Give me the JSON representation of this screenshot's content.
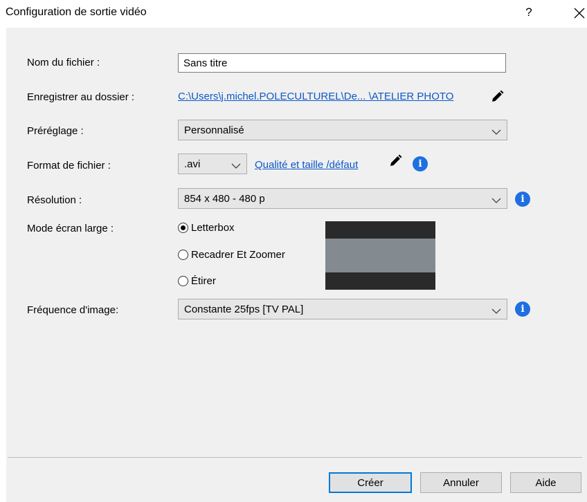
{
  "window": {
    "title": "Configuration de sortie vidéo",
    "help_label": "?"
  },
  "form": {
    "filename": {
      "label": "Nom du fichier :",
      "value": "Sans titre"
    },
    "folder": {
      "label": "Enregistrer au dossier :",
      "path": "C:\\Users\\j.michel.POLECULTUREL\\De... \\ATELIER PHOTO"
    },
    "preset": {
      "label": "Préréglage :",
      "value": "Personnalisé"
    },
    "format": {
      "label": "Format de fichier :",
      "value": ".avi",
      "quality_link": "Qualité et taille /défaut"
    },
    "resolution": {
      "label": "Résolution :",
      "value": "854 x 480 - 480 p"
    },
    "widescreen": {
      "label": "Mode écran large :",
      "options": [
        "Letterbox",
        "Recadrer Et Zoomer",
        "Étirer"
      ],
      "selected": "Letterbox"
    },
    "framerate": {
      "label": "Fréquence d'image:",
      "value": "Constante 25fps [TV PAL]"
    }
  },
  "buttons": {
    "create": "Créer",
    "cancel": "Annuler",
    "help": "Aide"
  },
  "info_glyph": "i",
  "colors": {
    "link": "#0b57c8",
    "info": "#1e6fe0",
    "primary_border": "#0078d7",
    "panel_bg": "#f0f0f0"
  }
}
